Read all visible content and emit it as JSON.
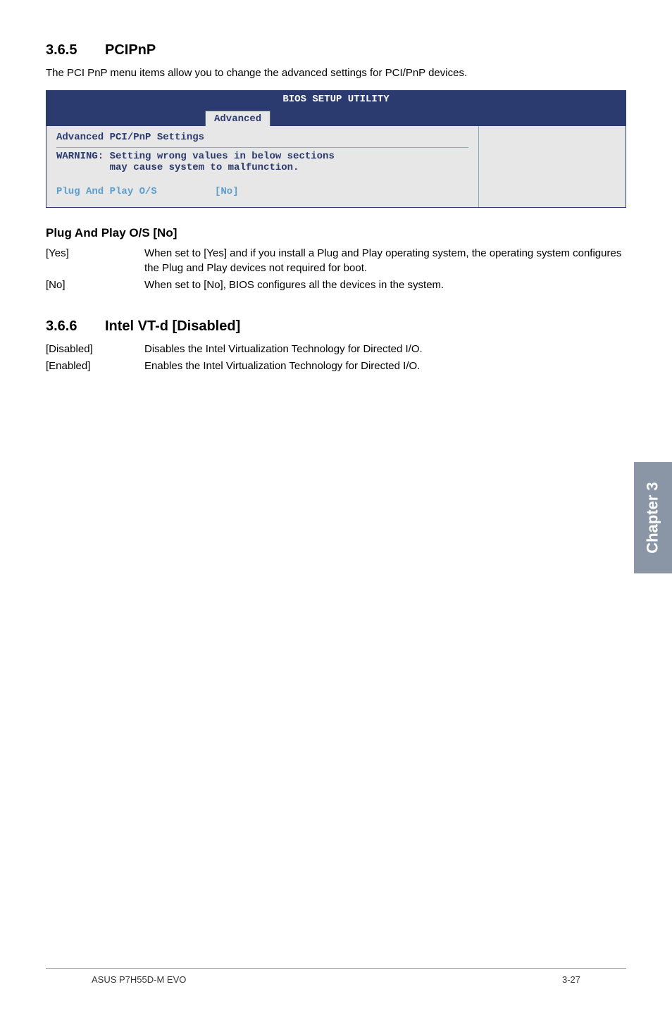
{
  "sections": {
    "pcipnp": {
      "number": "3.6.5",
      "title": "PCIPnP",
      "intro": "The PCI PnP menu items allow you to change the advanced settings for PCI/PnP devices."
    },
    "vtd": {
      "number": "3.6.6",
      "title": "Intel VT-d [Disabled]"
    }
  },
  "bios": {
    "title": "BIOS SETUP UTILITY",
    "tab": "Advanced",
    "settings_title": "Advanced PCI/PnP Settings",
    "warning": "WARNING: Setting wrong values in below sections\n         may cause system to malfunction.",
    "option_label": "Plug And Play O/S",
    "option_value": "[No]"
  },
  "plug_and_play": {
    "heading": "Plug And Play O/S [No]",
    "rows": {
      "yes_label": "[Yes]",
      "yes_body": "When set to [Yes] and if you install a Plug and Play operating system, the operating system configures the Plug and Play devices not required for boot.",
      "no_label": "[No]",
      "no_body": "When set to [No], BIOS configures all the devices in the system."
    }
  },
  "vtd_rows": {
    "disabled_label": "[Disabled]",
    "disabled_body": "Disables the Intel Virtualization Technology for Directed I/O.",
    "enabled_label": "[Enabled]",
    "enabled_body": "Enables the Intel Virtualization Technology for Directed I/O."
  },
  "chapter_tab": "Chapter 3",
  "footer": {
    "left": "ASUS P7H55D-M EVO",
    "right": "3-27"
  }
}
